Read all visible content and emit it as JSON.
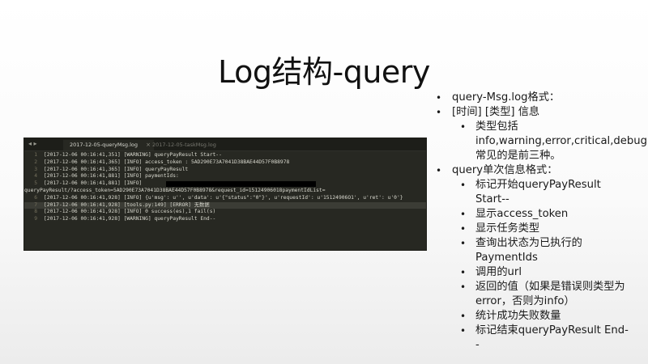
{
  "slide": {
    "title": "Log结构-query"
  },
  "editor": {
    "tabs": [
      {
        "label": "2017-12-05-queryMsg.log",
        "active": true
      },
      {
        "label": "2017-12-05-taskMsg.log",
        "active": false
      }
    ],
    "lines": [
      {
        "num": "1",
        "text": "[2017-12-06 00:16:41,351] [WARNING] queryPayResult Start--"
      },
      {
        "num": "2",
        "text": "[2017-12-06 00:16:41,365] [INFO] access_token : 5AD290E73A7041D38BAE44D57F0B8978"
      },
      {
        "num": "3",
        "text": "[2017-12-06 00:16:41,365] [INFO] queryPayResult"
      },
      {
        "num": "4",
        "text": "[2017-12-06 00:16:41,881] [INFO] paymentIds:"
      },
      {
        "num": "5",
        "text": "[2017-12-06 00:16:41,881] [INFO] "
      },
      {
        "num": "",
        "text": "queryPayResult/?access_token=5AD290E73A7041D38BAE44D57F0B8978&request_id=15124906018paymentIdList="
      },
      {
        "num": "6",
        "text": "[2017-12-06 00:16:41,928] [INFO] {u'msg': u'', u'data': u'{\"status\":\"0\"}', u'requestId': u'15124906O1', u'ret': u'0'}"
      },
      {
        "num": "7",
        "text": "[2017-12-06 00:16:41,928] [tools.py:149] [ERROR] 无数据"
      },
      {
        "num": "8",
        "text": "[2017-12-06 00:16:41,928] [INFO] 0 success(es),1 fail(s)"
      },
      {
        "num": "9",
        "text": "[2017-12-06 00:16:41,928] [WARNING] queryPayResult End--"
      }
    ]
  },
  "bullets": {
    "items": [
      {
        "label": "query-Msg.log格式：",
        "level": 1
      },
      {
        "label": "[时间] [类型] 信息",
        "level": 1
      },
      {
        "label": "类型包括info,warning,error,critical,debug.常见的是前三种。",
        "level": 2
      },
      {
        "label": "query单次信息格式：",
        "level": 1
      },
      {
        "label": "标记开始queryPayResult Start--",
        "level": 2
      },
      {
        "label": "显示access_token",
        "level": 2
      },
      {
        "label": "显示任务类型",
        "level": 2
      },
      {
        "label": "查询出状态为已执行的PaymentIds",
        "level": 2
      },
      {
        "label": "调用的url",
        "level": 2
      },
      {
        "label": "返回的值（如果是错误则类型为error，否则为info）",
        "level": 2
      },
      {
        "label": "统计成功失败数量",
        "level": 2
      },
      {
        "label": "标记结束queryPayResult End--",
        "level": 2
      }
    ]
  }
}
